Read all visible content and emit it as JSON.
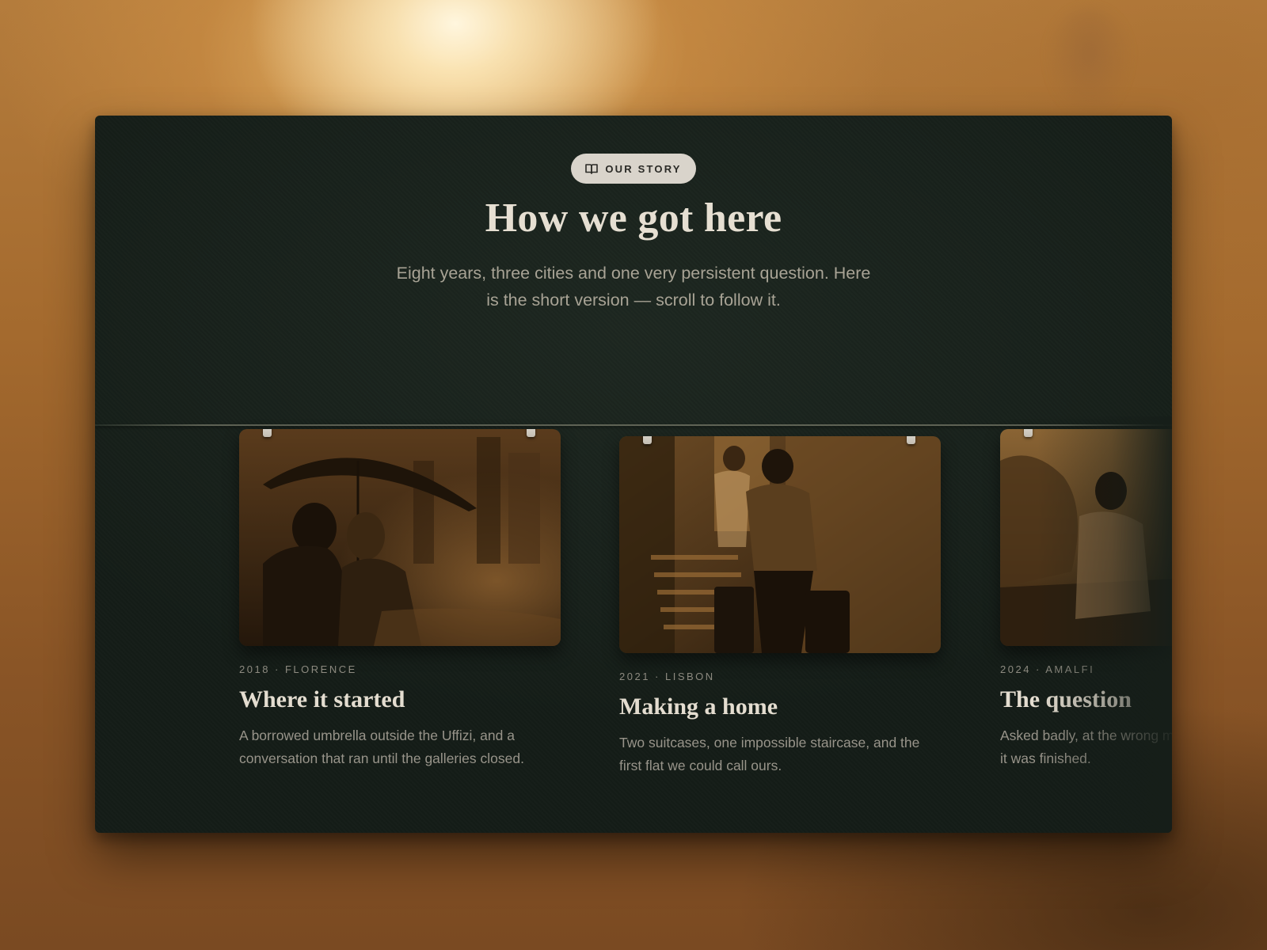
{
  "section": {
    "badge_label": "OUR STORY",
    "badge_icon": "book-icon",
    "title": "How we got here",
    "subtitle": "Eight years, three cities and one very persistent question. Here is the short version — scroll to follow it."
  },
  "timeline": [
    {
      "meta": "2018 · FLORENCE",
      "title": "Where it started",
      "text": "A borrowed umbrella outside the Uffizi, and a conversation that ran until the galleries closed.",
      "photo": "couple under umbrella on rainy street"
    },
    {
      "meta": "2021 · LISBON",
      "title": "Making a home",
      "text": "Two suitcases, one impossible staircase, and the first flat we could call ours.",
      "photo": "couple carrying suitcases up a staircase"
    },
    {
      "meta": "2024 · AMALFI",
      "title": "The question",
      "text": "Asked badly, at the wrong moment, answered before it was finished.",
      "photo": "person sitting on cliff by the sea"
    }
  ],
  "colors": {
    "panel_bg": "#18211b",
    "badge_bg": "#d9d4cb",
    "title_text": "#e6dfd2",
    "body_text": "#98948a",
    "sepia": "#8a5a28"
  }
}
